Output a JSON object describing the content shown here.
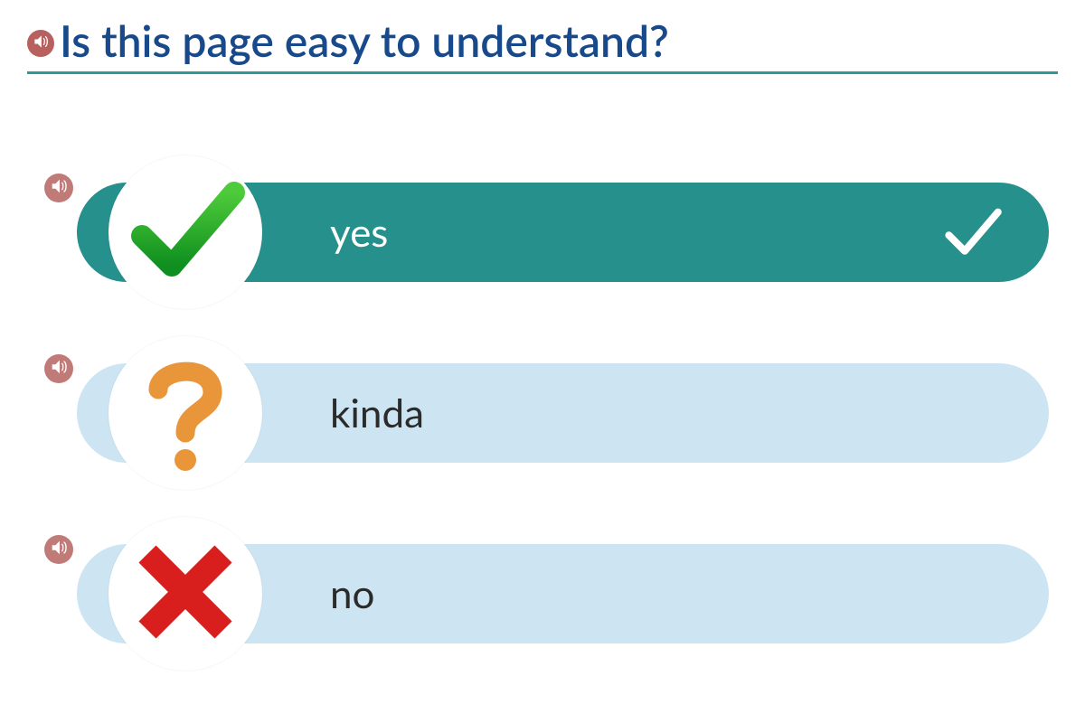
{
  "question": {
    "text": "Is this page easy to understand?"
  },
  "options": {
    "yes": {
      "label": "yes",
      "selected": true
    },
    "kinda": {
      "label": "kinda",
      "selected": false
    },
    "no": {
      "label": "no",
      "selected": false
    }
  },
  "colors": {
    "accent": "#299a97",
    "title": "#184a8b",
    "optionSelected": "#25908c",
    "optionUnselected": "#cde5f2",
    "audioIcon": "#b7605e"
  }
}
